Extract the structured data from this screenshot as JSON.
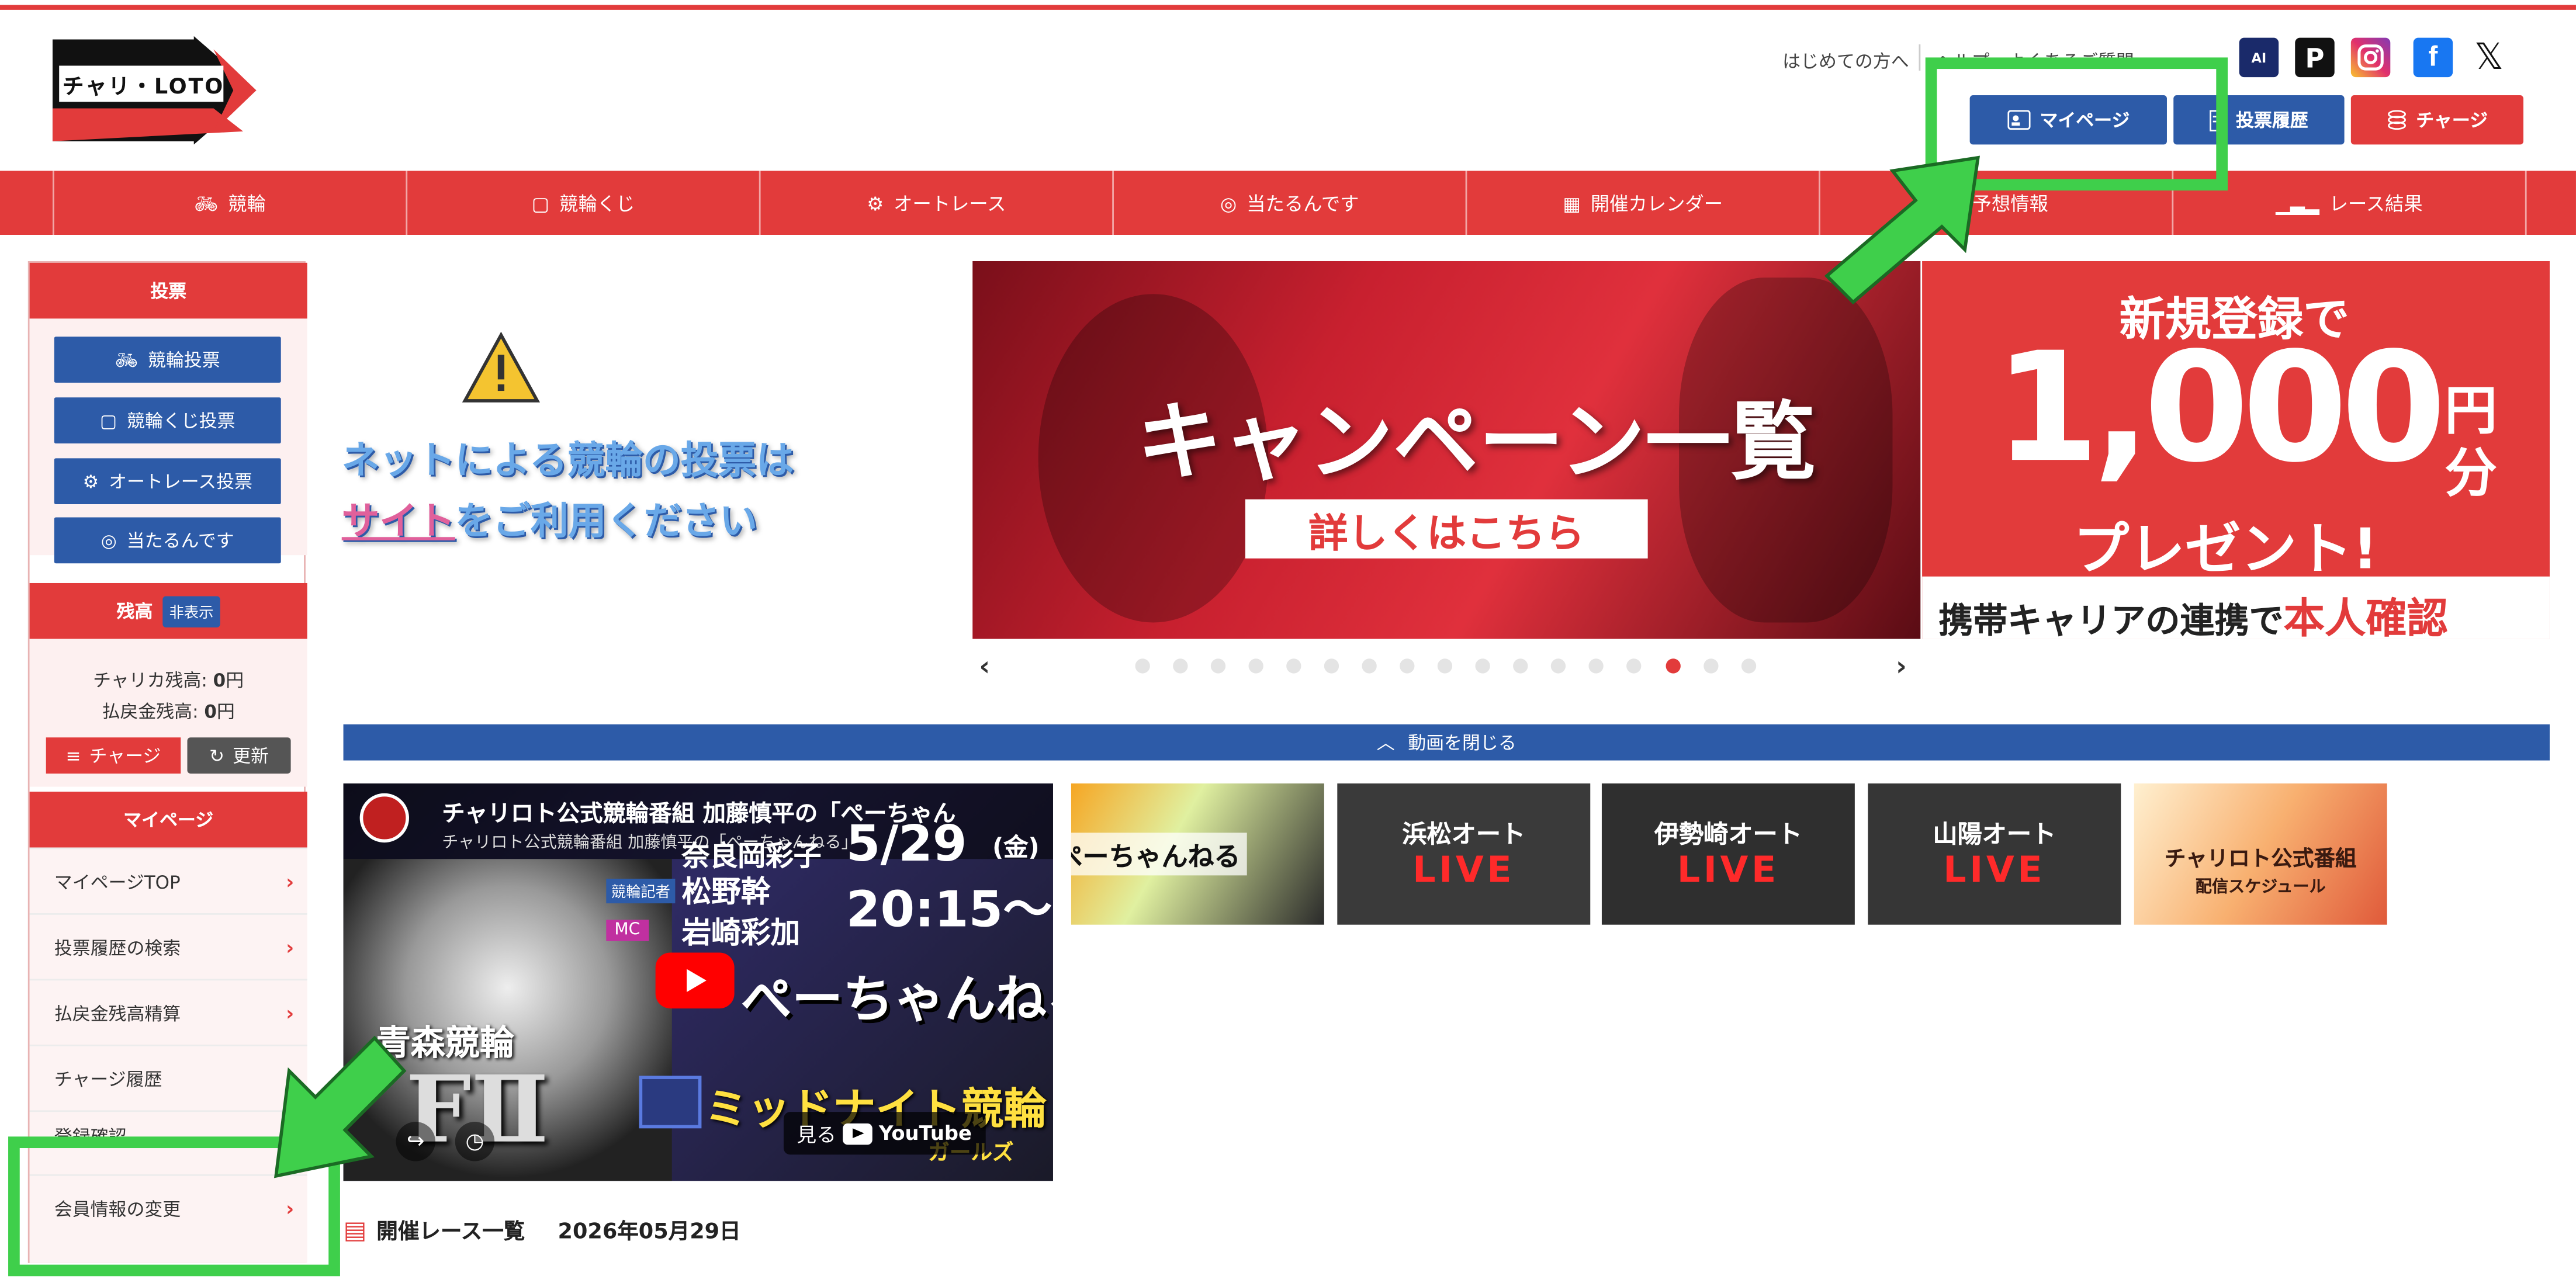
{
  "header": {
    "logo_text": "チャリ・LOTO",
    "first_time_link": "はじめての方へ",
    "help_link": "ヘルプ・よくあるご質問",
    "sns": [
      "ai-keirin-icon",
      "p-icon",
      "instagram-icon",
      "facebook-icon",
      "x-icon"
    ],
    "buttons": {
      "mypage": "マイページ",
      "history": "投票履歴",
      "charge": "チャージ"
    }
  },
  "nav": {
    "items": [
      {
        "label": "競輪",
        "icon": "bicycle-icon"
      },
      {
        "label": "競輪くじ",
        "icon": "ticket-icon"
      },
      {
        "label": "オートレース",
        "icon": "motorbike-icon"
      },
      {
        "label": "当たるんです",
        "icon": "target-icon"
      },
      {
        "label": "開催カレンダー",
        "icon": "calendar-icon"
      },
      {
        "label": "予想情報",
        "icon": "info-icon"
      },
      {
        "label": "レース結果",
        "icon": "podium-icon"
      }
    ]
  },
  "sidebar": {
    "vote_heading": "投票",
    "vote_buttons": [
      "競輪投票",
      "競輪くじ投票",
      "オートレース投票",
      "当たるんです"
    ],
    "balance_heading": "残高",
    "balance_toggle": "非表示",
    "chariqa_label": "チャリカ残高:",
    "chariqa_value": "0",
    "chariqa_unit": "円",
    "refund_label": "払戻金残高:",
    "refund_value": "0",
    "refund_unit": "円",
    "charge_button": "チャージ",
    "refresh_button": "更新",
    "mypage_heading": "マイページ",
    "mypage_items": [
      "マイページTOP",
      "投票履歴の検索",
      "払戻金残高精算",
      "チャージ履歴",
      "登録確認",
      "会員情報の変更"
    ]
  },
  "notice": {
    "line1": "ネットによる競輪の投票は",
    "line2_link": "サイト",
    "line2_rest": "をご利用ください"
  },
  "banner_campaign": {
    "title": "キャンペーン一覧",
    "cta": "詳しくはこちら"
  },
  "banner_signup": {
    "line1": "新規登録で",
    "amount": "1,000",
    "unit_top": "円",
    "unit_bottom": "分",
    "line3": "プレゼント!",
    "line4_a": "携帯キャリアの連携で",
    "line4_b": "本人確認"
  },
  "carousel": {
    "dot_count": 17,
    "active_index": 14
  },
  "video_bar": {
    "label": "動画を閉じる"
  },
  "video": {
    "title": "チャリロト公式競輪番組 加藤慎平の「ぺーちゃん",
    "subtitle": "チャリロト公式競輪番組 加藤慎平の「ぺーちゃんねる」",
    "date": "5/29",
    "day": "(金)",
    "time": "20:15〜",
    "guest_role": "競輪記者",
    "guest_name_1": "奈良岡彩子",
    "guest_name_2": "松野幹",
    "mc_role": "MC",
    "mc_name": "岩崎彩加",
    "channel_name": "ぺーちゃんねる",
    "venue": "青森競輪",
    "grade": "FⅡ",
    "series": "ミッドナイト競輪",
    "series_sub": "ガールズ",
    "watch_on": "見る",
    "platform": "YouTube"
  },
  "thumbnails": [
    {
      "line1": "ぺーちゃんねる",
      "line2": ""
    },
    {
      "line1": "浜松オート",
      "line2": "LIVE"
    },
    {
      "line1": "伊勢崎オート",
      "line2": "LIVE"
    },
    {
      "line1": "山陽オート",
      "line2": "LIVE"
    },
    {
      "line1": "チャリロト公式番組",
      "line2": "配信スケジュール"
    }
  ],
  "race_list": {
    "heading": "開催レース一覧",
    "date": "2026年05月29日"
  },
  "colors": {
    "brand_red": "#e23b3b",
    "brand_blue": "#2d5ba8",
    "highlight_green": "#3fcf4b"
  }
}
